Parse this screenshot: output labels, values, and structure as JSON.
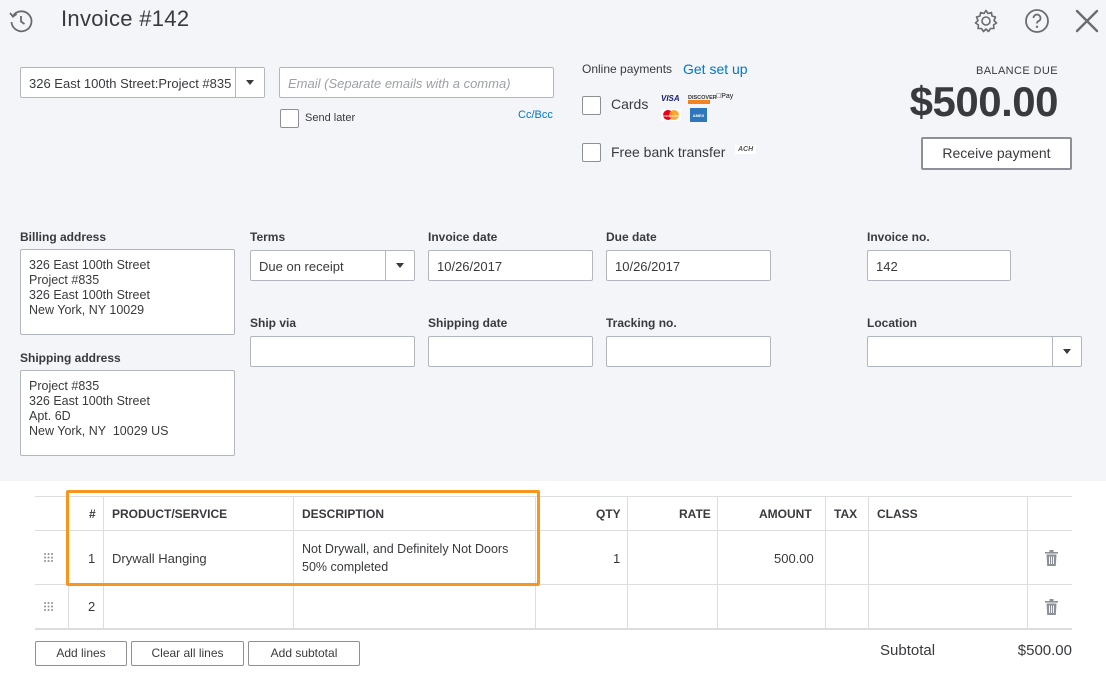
{
  "header": {
    "title": "Invoice #142",
    "icons": [
      "history-icon",
      "gear-icon",
      "help-icon",
      "close-icon"
    ]
  },
  "customer": {
    "selected": "326 East 100th Street:Project #835",
    "email_placeholder": "Email (Separate emails with a comma)",
    "send_later_label": "Send later",
    "cc_bcc_label": "Cc/Bcc"
  },
  "online_payments": {
    "label": "Online payments",
    "setup_link": "Get set up",
    "cards_label": "Cards",
    "bank_label": "Free bank transfer",
    "card_logos": [
      "VISA",
      "DISCOVER",
      "Pay",
      "mastercard",
      "AMEX"
    ],
    "ach_label": "ACH"
  },
  "balance": {
    "label": "BALANCE DUE",
    "amount": "$500.00",
    "receive_button": "Receive payment"
  },
  "billing": {
    "label": "Billing address",
    "lines": [
      "326 East 100th Street",
      "Project #835",
      "326 East 100th Street",
      "New York, NY 10029"
    ]
  },
  "shipping_address": {
    "label": "Shipping address",
    "lines": [
      "Project #835",
      "326 East 100th Street",
      "Apt. 6D",
      "New York, NY  10029 US"
    ]
  },
  "terms": {
    "label": "Terms",
    "value": "Due on receipt"
  },
  "invoice_date": {
    "label": "Invoice date",
    "value": "10/26/2017"
  },
  "due_date": {
    "label": "Due date",
    "value": "10/26/2017"
  },
  "invoice_no": {
    "label": "Invoice no.",
    "value": "142"
  },
  "ship_via": {
    "label": "Ship via",
    "value": ""
  },
  "shipping_date": {
    "label": "Shipping date",
    "value": ""
  },
  "tracking_no": {
    "label": "Tracking no.",
    "value": ""
  },
  "location": {
    "label": "Location",
    "value": ""
  },
  "table": {
    "columns": [
      "#",
      "PRODUCT/SERVICE",
      "DESCRIPTION",
      "QTY",
      "RATE",
      "AMOUNT",
      "TAX",
      "CLASS"
    ],
    "rows": [
      {
        "num": "1",
        "product": "Drywall Hanging",
        "description_line1": "Not Drywall, and Definitely Not Doors",
        "description_line2": "50% completed",
        "qty": "1",
        "rate": "",
        "amount": "500.00",
        "tax": "",
        "class": ""
      },
      {
        "num": "2",
        "product": "",
        "description_line1": "",
        "description_line2": "",
        "qty": "",
        "rate": "",
        "amount": "",
        "tax": "",
        "class": ""
      }
    ]
  },
  "footer": {
    "add_lines": "Add lines",
    "clear_lines": "Clear all lines",
    "add_subtotal": "Add subtotal",
    "subtotal_label": "Subtotal",
    "subtotal_value": "$500.00"
  },
  "colors": {
    "link": "#0077c5",
    "highlight": "#f7961e",
    "panel_bg": "#f4f5f8"
  }
}
